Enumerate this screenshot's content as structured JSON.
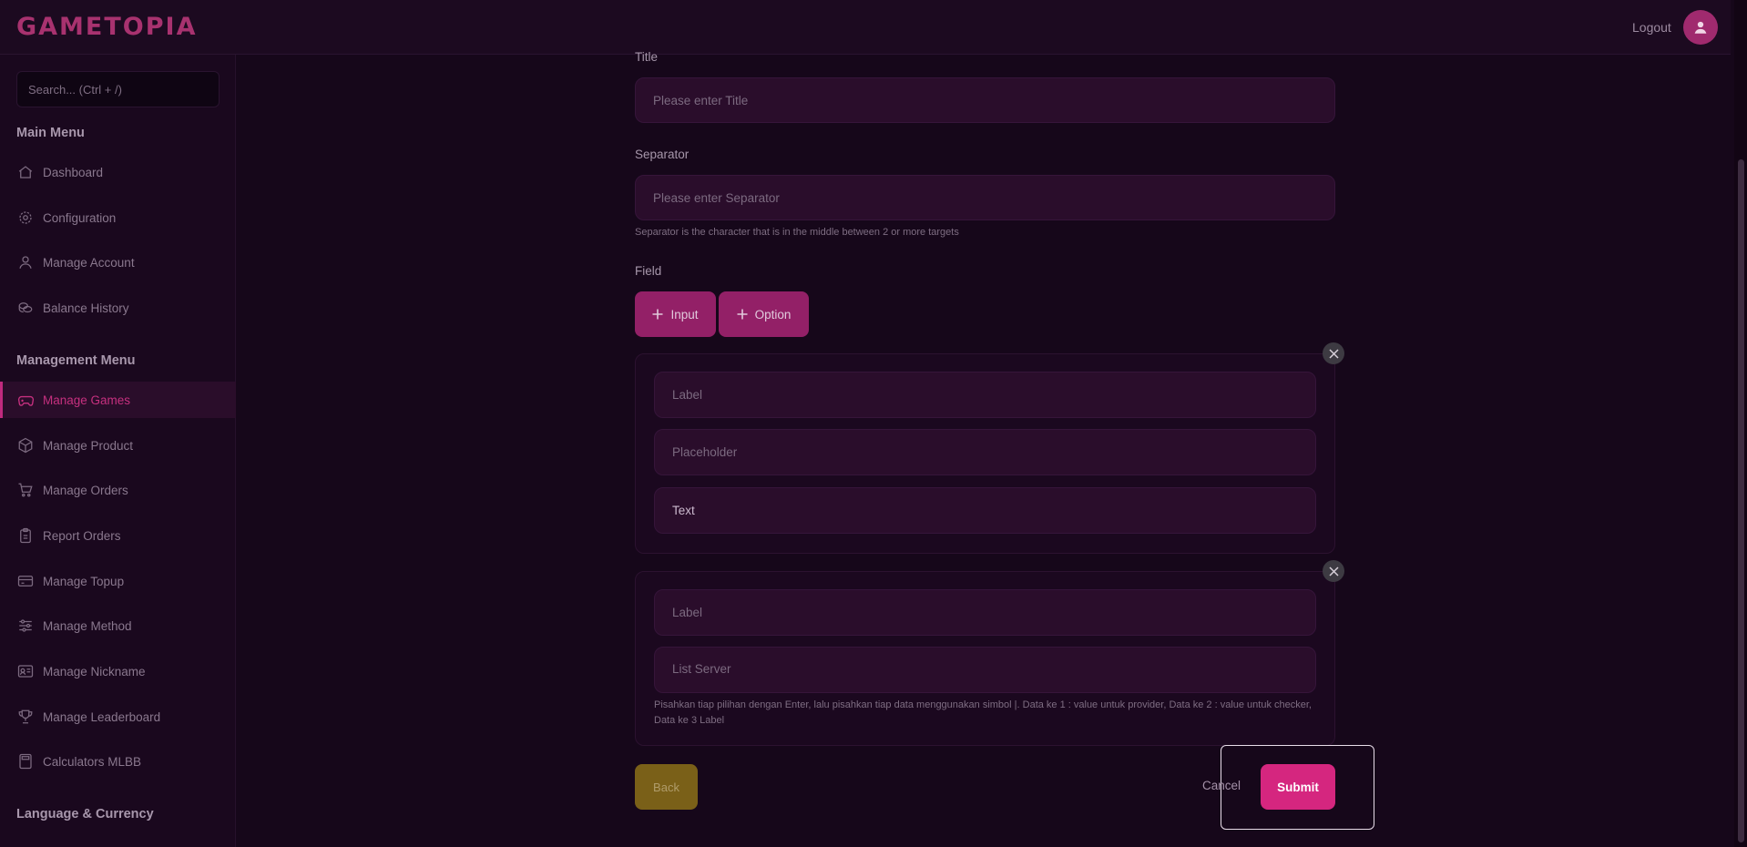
{
  "app": {
    "brand": "GAMETOPIA",
    "logout_label": "Logout"
  },
  "sidebar": {
    "search_placeholder": "Search... (Ctrl + /)",
    "main_menu_title": "Main Menu",
    "main_items": [
      {
        "label": "Dashboard",
        "icon": "home-icon"
      },
      {
        "label": "Configuration",
        "icon": "gear-icon"
      },
      {
        "label": "Manage Account",
        "icon": "user-icon"
      },
      {
        "label": "Balance History",
        "icon": "coins-icon"
      }
    ],
    "management_menu_title": "Management Menu",
    "management_items": [
      {
        "label": "Manage Games",
        "icon": "gamepad-icon",
        "active": true
      },
      {
        "label": "Manage Product",
        "icon": "box-icon"
      },
      {
        "label": "Manage Orders",
        "icon": "cart-icon"
      },
      {
        "label": "Report Orders",
        "icon": "clipboard-icon"
      },
      {
        "label": "Manage Topup",
        "icon": "card-icon"
      },
      {
        "label": "Manage Method",
        "icon": "sliders-icon"
      },
      {
        "label": "Manage Nickname",
        "icon": "id-card-icon"
      },
      {
        "label": "Manage Leaderboard",
        "icon": "trophy-icon"
      },
      {
        "label": "Calculators MLBB",
        "icon": "calculator-icon"
      }
    ],
    "language_title": "Language & Currency"
  },
  "form": {
    "title_label": "Title",
    "title_placeholder": "Please enter Title",
    "separator_label": "Separator",
    "separator_placeholder": "Please enter Separator",
    "separator_help": "Separator is the character that is in the middle between 2 or more targets",
    "field_label": "Field",
    "add_input_label": "Input",
    "add_option_label": "Option",
    "input_group": {
      "label_placeholder": "Label",
      "placeholder_placeholder": "Placeholder",
      "type_value": "Text"
    },
    "option_group": {
      "label_placeholder": "Label",
      "list_placeholder": "List Server",
      "help": "Pisahkan tiap pilihan dengan Enter, lalu pisahkan tiap data menggunakan simbol |. Data ke 1 : value untuk provider, Data ke 2 : value untuk checker, Data ke 3 Label"
    },
    "back_label": "Back",
    "cancel_label": "Cancel",
    "submit_label": "Submit"
  },
  "colors": {
    "accent": "#d5267f",
    "brand": "#a8326f",
    "back": "#7a6018",
    "background": "#16071a"
  }
}
